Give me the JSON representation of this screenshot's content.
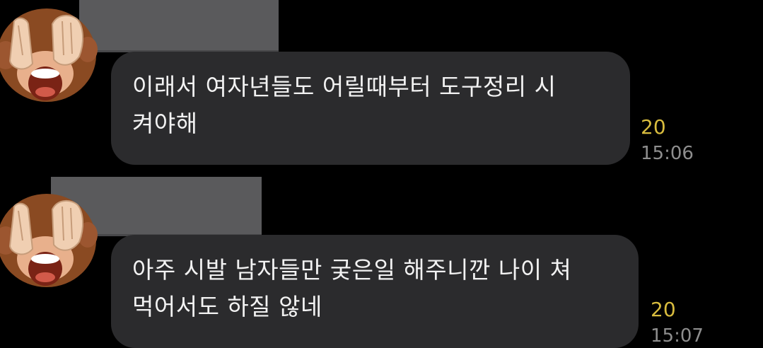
{
  "messages": [
    {
      "sender_avatar_icon": "see-no-evil-monkey-icon",
      "text_line1": "이래서 여자년들도 어릴때부터 도구정리 시",
      "text_line2": "켜야해",
      "unread_count": "20",
      "time": "15:06"
    },
    {
      "sender_avatar_icon": "see-no-evil-monkey-icon",
      "text_line1": "아주 시발 남자들만 궂은일 해주니깐 나이 쳐",
      "text_line2": "먹어서도 하질 않네",
      "unread_count": "20",
      "time": "15:07"
    }
  ],
  "colors": {
    "background": "#000000",
    "bubble": "#2b2b2d",
    "unread": "#d8bc3e",
    "time": "#8e8e8e",
    "redaction": "#5a5a5c"
  }
}
